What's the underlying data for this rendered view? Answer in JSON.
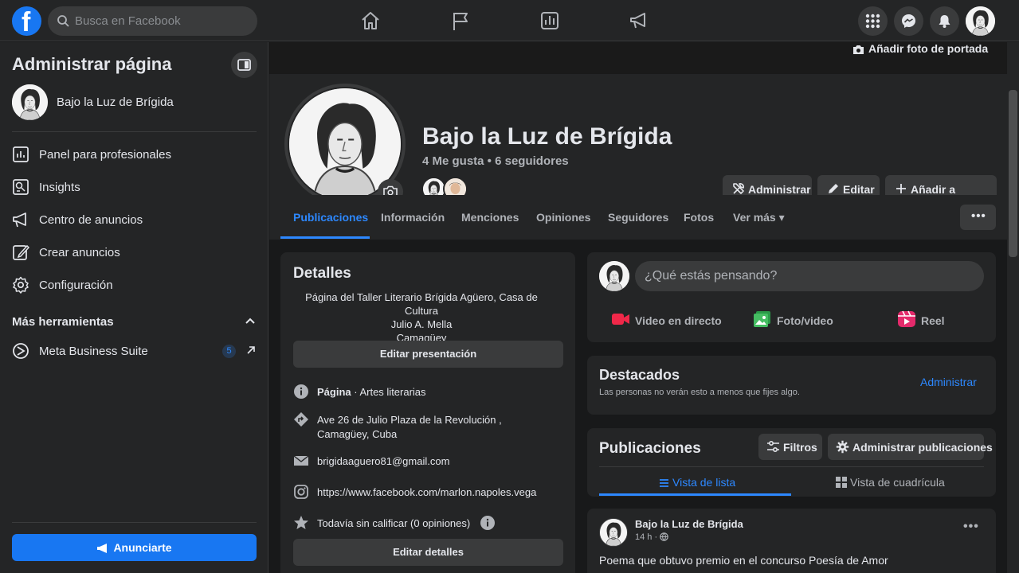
{
  "topbar": {
    "logo": "f",
    "search_placeholder": "Busca en Facebook",
    "icons": [
      "home-icon",
      "flag-icon",
      "chart-icon",
      "megaphone-icon",
      "menu-grid-icon",
      "messenger-icon",
      "bell-icon"
    ]
  },
  "sidebar": {
    "title": "Administrar página",
    "page_name": "Bajo la Luz de Brígida",
    "items": [
      {
        "label": "Panel para profesionales",
        "icon": "dashboard-icon"
      },
      {
        "label": "Insights",
        "icon": "insights-icon"
      },
      {
        "label": "Centro de anuncios",
        "icon": "megaphone-icon"
      },
      {
        "label": "Crear anuncios",
        "icon": "pencil-icon"
      },
      {
        "label": "Configuración",
        "icon": "gear-icon"
      }
    ],
    "section_title": "Más herramientas",
    "tool": {
      "label": "Meta Business Suite",
      "badge": "5"
    },
    "cta": "Anunciarte"
  },
  "cover": {
    "add_cover_label": "Añadir foto de portada"
  },
  "profile": {
    "name": "Bajo la Luz de Brígida",
    "stats": "4 Me gusta • 6 seguidores",
    "buttons": {
      "admin": "Administrar",
      "edit": "Editar",
      "story": "Añadir a historia"
    }
  },
  "tabs": {
    "items": [
      "Publicaciones",
      "Información",
      "Menciones",
      "Opiniones",
      "Seguidores",
      "Fotos",
      "Ver más ▾"
    ],
    "active": "Publicaciones",
    "more": "•••"
  },
  "details": {
    "title": "Detalles",
    "description_lines": [
      "Página del Taller Literario Brígida Agüero, Casa de Cultura",
      "Julio A. Mella",
      "Camagüey"
    ],
    "edit_presentation": "Editar presentación",
    "category_bold": "Página",
    "category_rest": " · Artes literarias",
    "address": "Ave 26 de Julio Plaza de la Revolución , Camagüey, Cuba",
    "email": "brigidaaguero81@gmail.com",
    "website": "https://www.facebook.com/marlon.napoles.vega",
    "rating": "Todavía sin calificar (0 opiniones)",
    "edit_details": "Editar detalles"
  },
  "composer": {
    "placeholder": "¿Qué estás pensando?",
    "actions": [
      "Video en directo",
      "Foto/video",
      "Reel"
    ]
  },
  "featured": {
    "title": "Destacados",
    "subtitle": "Las personas no verán esto a menos que fijes algo.",
    "manage": "Administrar"
  },
  "posts": {
    "title": "Publicaciones",
    "filters": "Filtros",
    "manage": "Administrar publicaciones",
    "list_view": "Vista de lista",
    "grid_view": "Vista de cuadrícula",
    "post": {
      "author": "Bajo la Luz de Brígida",
      "time": "14 h ·",
      "text": "Poema que obtuvo premio en el concurso Poesía de Amor"
    }
  },
  "colors": {
    "accent": "#2d88ff",
    "brand": "#1877f2",
    "surface": "#242526",
    "background": "#18191a"
  }
}
